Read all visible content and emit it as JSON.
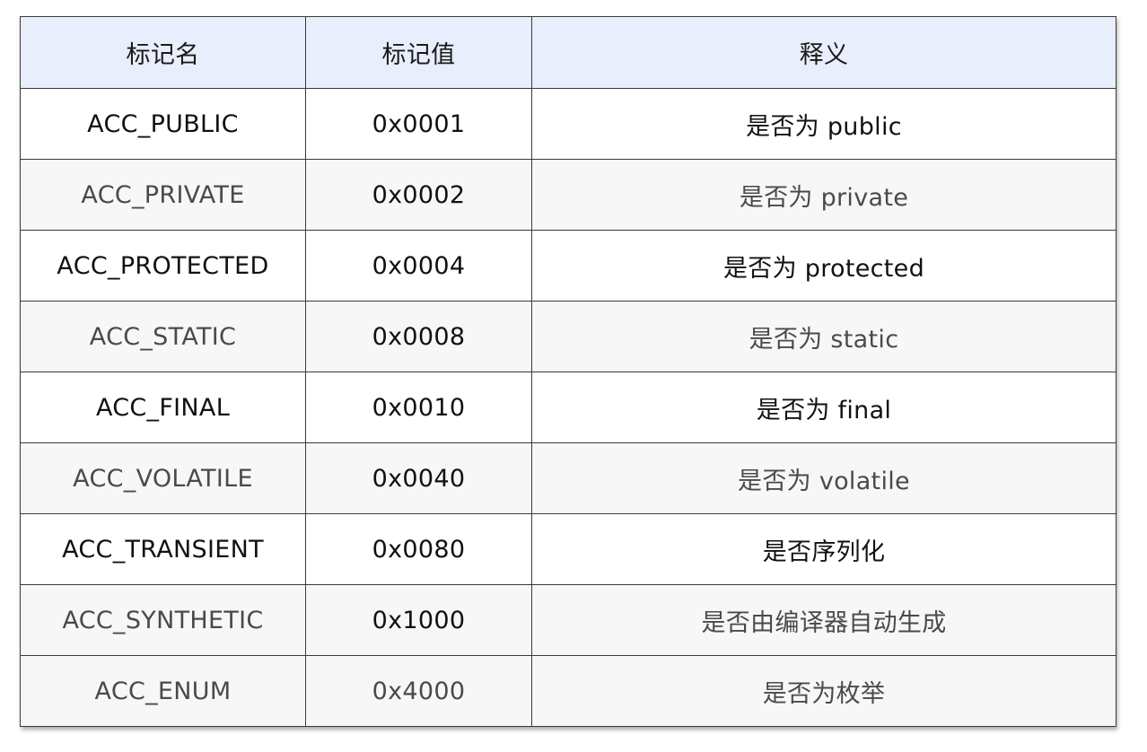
{
  "table": {
    "headers": [
      "标记名",
      "标记值",
      "释义"
    ],
    "rows": [
      {
        "name": "ACC_PUBLIC",
        "value": "0x0001",
        "meaning": "是否为 public"
      },
      {
        "name": "ACC_PRIVATE",
        "value": "0x0002",
        "meaning": "是否为 private"
      },
      {
        "name": "ACC_PROTECTED",
        "value": "0x0004",
        "meaning": "是否为 protected"
      },
      {
        "name": "ACC_STATIC",
        "value": "0x0008",
        "meaning": "是否为 static"
      },
      {
        "name": "ACC_FINAL",
        "value": "0x0010",
        "meaning": "是否为 final"
      },
      {
        "name": "ACC_VOLATILE",
        "value": "0x0040",
        "meaning": "是否为 volatile"
      },
      {
        "name": "ACC_TRANSIENT",
        "value": "0x0080",
        "meaning": "是否序列化"
      },
      {
        "name": "ACC_SYNTHETIC",
        "value": "0x1000",
        "meaning": "是否由编译器自动生成"
      },
      {
        "name": "ACC_ENUM",
        "value": "0x4000",
        "meaning": "是否为枚举"
      }
    ]
  },
  "colors": {
    "header_bg": "#e8eefb",
    "row_alt_bg": "#f7f7f7",
    "border": "#3a3a3a"
  }
}
